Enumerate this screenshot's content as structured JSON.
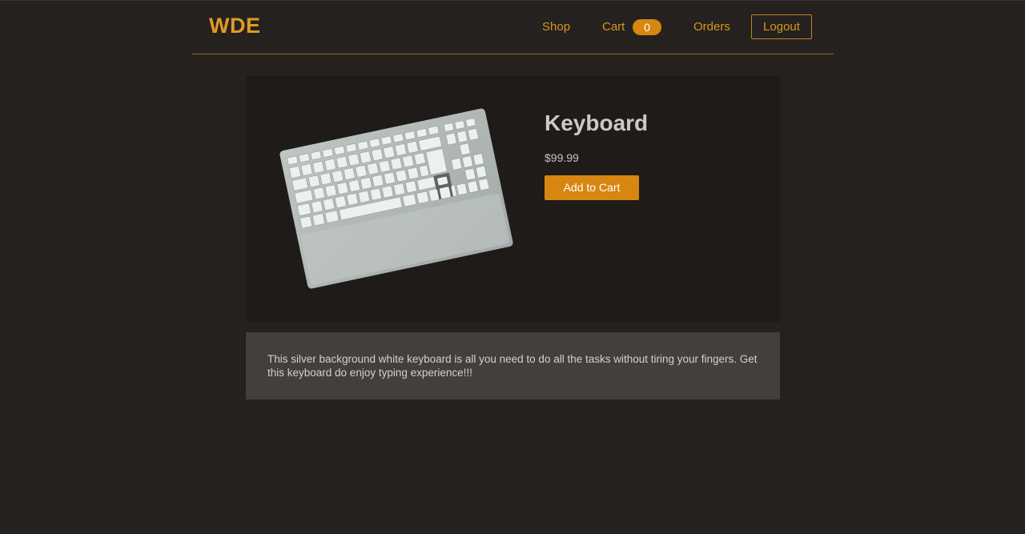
{
  "brand": {
    "logo": "WDE"
  },
  "nav": {
    "shop": "Shop",
    "cart": "Cart",
    "cart_count": "0",
    "orders": "Orders",
    "logout": "Logout"
  },
  "product": {
    "title": "Keyboard",
    "price": "$99.99",
    "add_to_cart": "Add to Cart",
    "image_icon": "keyboard-photo",
    "description": "This silver background white keyboard is all you need to do all the tasks without tiring your fingers. Get this keyboard do enjoy typing experience!!!"
  },
  "colors": {
    "accent": "#d78612",
    "background": "#25211f",
    "card": "#1e1b19",
    "description_bg": "#433f3c"
  }
}
